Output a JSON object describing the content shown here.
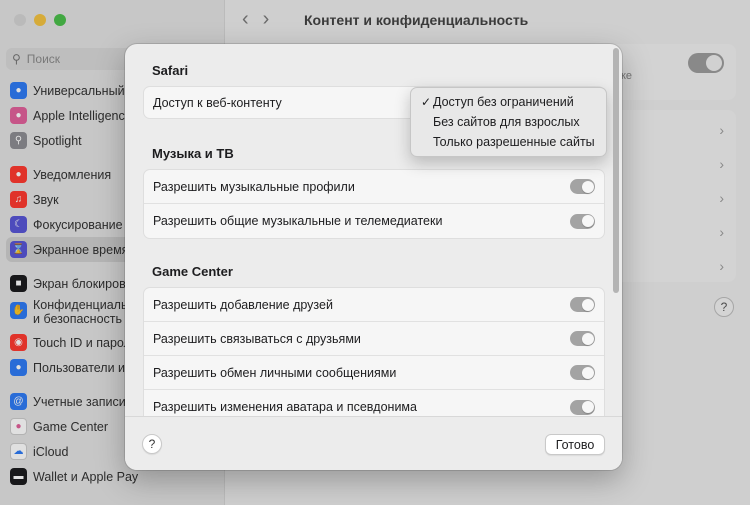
{
  "window": {
    "title": "Контент и конфиденциальность",
    "search_placeholder": "Поиск",
    "nav_back": "‹",
    "nav_forward": "›",
    "bg_fragment": "ке",
    "bg_help": "?"
  },
  "sidebar": {
    "items": [
      {
        "label": "Универсальный доступ",
        "color": "#2f7bf5",
        "icon": "accessibility-icon"
      },
      {
        "label": "Apple Intelligence и Siri",
        "color": "#e2619b",
        "icon": "siri-icon"
      },
      {
        "label": "Spotlight",
        "color": "#8e8e93",
        "icon": "spotlight-icon"
      },
      {
        "label": "Уведомления",
        "color": "#ff3b30",
        "icon": "bell-icon"
      },
      {
        "label": "Звук",
        "color": "#ff3b30",
        "icon": "sound-icon"
      },
      {
        "label": "Фокусирование",
        "color": "#5856d6",
        "icon": "moon-icon"
      },
      {
        "label": "Экранное время",
        "color": "#5856d6",
        "icon": "hourglass-icon"
      },
      {
        "label": "Экран блокировки",
        "color": "#1c1c1e",
        "icon": "lock-icon"
      },
      {
        "label": "Конфиденциальность",
        "label2": "и безопасность",
        "color": "#2f7bf5",
        "icon": "hand-icon"
      },
      {
        "label": "Touch ID и пароль",
        "color": "#ff3b30",
        "icon": "fingerprint-icon"
      },
      {
        "label": "Пользователи и группы",
        "color": "#2f7bf5",
        "icon": "users-icon"
      },
      {
        "label": "Учетные записи",
        "color": "#2f7bf5",
        "icon": "at-icon"
      },
      {
        "label": "Game Center",
        "color": "#ffffff",
        "icon": "game-center-icon"
      },
      {
        "label": "iCloud",
        "color": "#ffffff",
        "icon": "cloud-icon"
      },
      {
        "label": "Wallet и Apple Pay",
        "color": "#1c1c1e",
        "icon": "wallet-icon"
      }
    ]
  },
  "sheet": {
    "sections": [
      {
        "title": "Safari",
        "rows": [
          {
            "label": "Доступ к веб-контенту"
          }
        ]
      },
      {
        "title": "Музыка и ТВ",
        "rows": [
          {
            "label": "Разрешить музыкальные профили"
          },
          {
            "label": "Разрешить общие музыкальные и телемедиатеки"
          }
        ]
      },
      {
        "title": "Game Center",
        "rows": [
          {
            "label": "Разрешить добавление друзей"
          },
          {
            "label": "Разрешить связываться с друзьями"
          },
          {
            "label": "Разрешить обмен личными сообщениями"
          },
          {
            "label": "Разрешить изменения аватара и псевдонима"
          }
        ]
      }
    ],
    "dropdown": {
      "check": "✓",
      "options": [
        "Доступ без ограничений",
        "Без сайтов для взрослых",
        "Только разрешенные сайты"
      ],
      "selected": "Доступ без ограничений"
    },
    "help_label": "?",
    "done_label": "Готово"
  },
  "colors": {
    "toggle_on": "#a3a3a3",
    "close": "#c9c9c9",
    "minimize": "#f4c341",
    "zoom": "#4cc04c"
  }
}
